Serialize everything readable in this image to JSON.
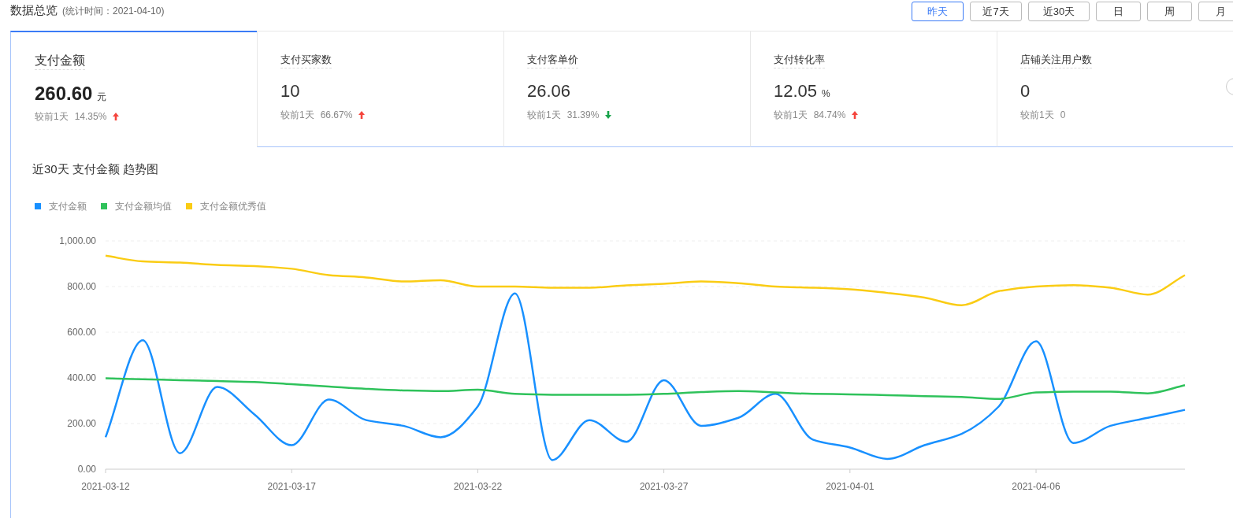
{
  "header": {
    "title": "数据总览",
    "subtitle": "(统计时间：2021-04-10)"
  },
  "range_buttons": [
    {
      "label": "昨天",
      "selected": true
    },
    {
      "label": "近7天",
      "selected": false
    },
    {
      "label": "近30天",
      "selected": false
    },
    {
      "label": "日",
      "selected": false
    },
    {
      "label": "周",
      "selected": false
    },
    {
      "label": "月",
      "selected": false
    }
  ],
  "cards": [
    {
      "title": "支付金额",
      "value": "260.60",
      "unit": "元",
      "compare_label": "较前1天",
      "change": "14.35%",
      "kind": "up",
      "selected": true
    },
    {
      "title": "支付买家数",
      "value": "10",
      "compare_label": "较前1天",
      "change": "66.67%",
      "kind": "up",
      "selected": false
    },
    {
      "title": "支付客单价",
      "value": "26.06",
      "compare_label": "较前1天",
      "change": "31.39%",
      "kind": "down",
      "selected": false
    },
    {
      "title": "支付转化率",
      "value": "12.05",
      "unit": "%",
      "compare_label": "较前1天",
      "change": "84.74%",
      "kind": "up",
      "selected": false
    },
    {
      "title": "店铺关注用户数",
      "value": "0",
      "compare_label": "较前1天",
      "change": "0",
      "kind": "none",
      "selected": false
    }
  ],
  "chart": {
    "title": "近30天 支付金额 趋势图",
    "chart_data": {
      "type": "line",
      "categories": [
        "2021-03-12",
        null,
        null,
        null,
        null,
        "2021-03-17",
        null,
        null,
        null,
        null,
        "2021-03-22",
        null,
        null,
        null,
        null,
        "2021-03-27",
        null,
        null,
        null,
        null,
        "2021-04-01",
        null,
        null,
        null,
        null,
        "2021-04-06",
        null,
        null,
        null,
        null
      ],
      "ylim": [
        0,
        1000
      ],
      "grid": true,
      "yticks": [
        {
          "value": 0,
          "label": "0.00"
        },
        {
          "value": 200,
          "label": "200.00"
        },
        {
          "value": 400,
          "label": "400.00"
        },
        {
          "value": 600,
          "label": "600.00"
        },
        {
          "value": 800,
          "label": "800.00"
        },
        {
          "value": 1000,
          "label": "1,000.00"
        }
      ],
      "series": [
        {
          "name": "支付金额",
          "color": "#1890ff",
          "values": [
            140,
            565,
            70,
            360,
            240,
            105,
            305,
            215,
            190,
            140,
            275,
            770,
            40,
            215,
            120,
            390,
            190,
            225,
            330,
            130,
            95,
            45,
            105,
            155,
            275,
            560,
            115,
            190,
            225,
            260
          ]
        },
        {
          "name": "支付金额均值",
          "color": "#2fc25b",
          "values": [
            398,
            394,
            390,
            386,
            382,
            372,
            362,
            352,
            345,
            342,
            348,
            330,
            326,
            326,
            326,
            330,
            338,
            342,
            336,
            330,
            328,
            324,
            320,
            316,
            308,
            336,
            340,
            340,
            332,
            368
          ]
        },
        {
          "name": "支付金额优秀值",
          "color": "#facc14",
          "values": [
            935,
            910,
            905,
            895,
            890,
            878,
            850,
            840,
            822,
            828,
            800,
            800,
            795,
            795,
            805,
            812,
            822,
            815,
            800,
            795,
            788,
            772,
            752,
            718,
            780,
            800,
            806,
            795,
            765,
            850
          ]
        }
      ]
    }
  }
}
